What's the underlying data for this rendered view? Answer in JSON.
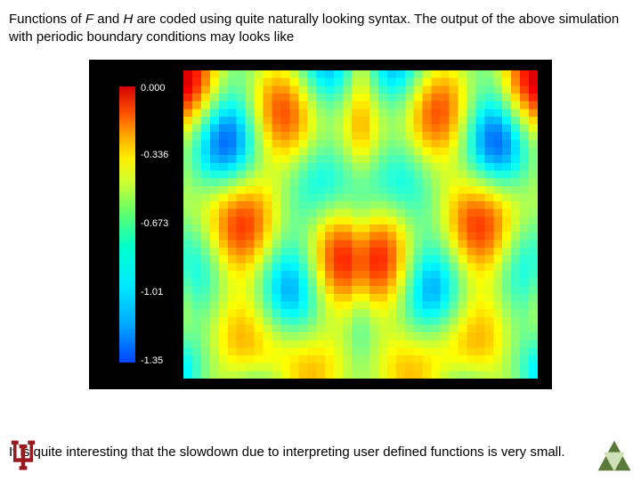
{
  "intro": {
    "part1": "Functions of ",
    "F": "F",
    "part2": " and ",
    "H": "H",
    "part3": " are coded using quite naturally looking syntax. The output of the above simulation with periodic boundary conditions may looks like"
  },
  "outro": "It is quite interesting that the slowdown due to interpreting user defined functions is very small.",
  "colorbar": {
    "labels": [
      "0.000",
      "-0.336",
      "-0.673",
      "-1.01",
      "-1.35"
    ],
    "positions_pct": [
      0,
      25,
      50,
      75,
      100
    ]
  },
  "chart_data": {
    "type": "heatmap",
    "title": "",
    "xlabel": "",
    "ylabel": "",
    "colormap": "jet",
    "value_range": [
      -1.35,
      0.0
    ],
    "colorbar_ticks": [
      0.0,
      -0.336,
      -0.673,
      -1.01,
      -1.35
    ],
    "grid_cells": [
      40,
      40
    ],
    "description": "Periodic-boundary simulation output; scalar field colored with jet palette (blue = low, red = high); bilaterally symmetric turbulent pattern dominated by cyan/green regions with scattered deep-blue minima and very few warm-colored maxima.",
    "representative_values": {
      "background_dominant": -0.55,
      "bright_green_ridges": -0.35,
      "dark_blue_pockets": -1.2,
      "warm_spots": -0.05
    }
  },
  "logos": {
    "left": "indiana-university-trident",
    "right": "nvidia-hourglass-style-mark"
  }
}
